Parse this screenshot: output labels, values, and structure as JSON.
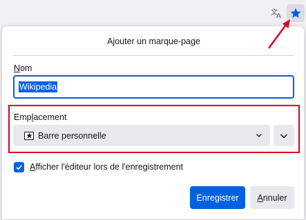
{
  "toolbar": {
    "translate_icon": "translate-icon",
    "bookmark_star_icon": "star-filled-icon"
  },
  "panel": {
    "title": "Ajouter un marque-page",
    "name_label_first": "N",
    "name_label_rest": "om",
    "name_value": "Wikipedia",
    "location_label_first": "Emp",
    "location_label_underlined": "l",
    "location_label_rest": "acement",
    "location_value": "Barre personnelle",
    "checkbox_checked": true,
    "checkbox_label_first": "A",
    "checkbox_label_rest": "fficher l'éditeur lors de l'enregistrement",
    "save_label": "Enregistrer",
    "cancel_label_first": "A",
    "cancel_label_rest": "nnuler"
  },
  "colors": {
    "accent": "#0061e0",
    "highlight": "#d70022"
  }
}
